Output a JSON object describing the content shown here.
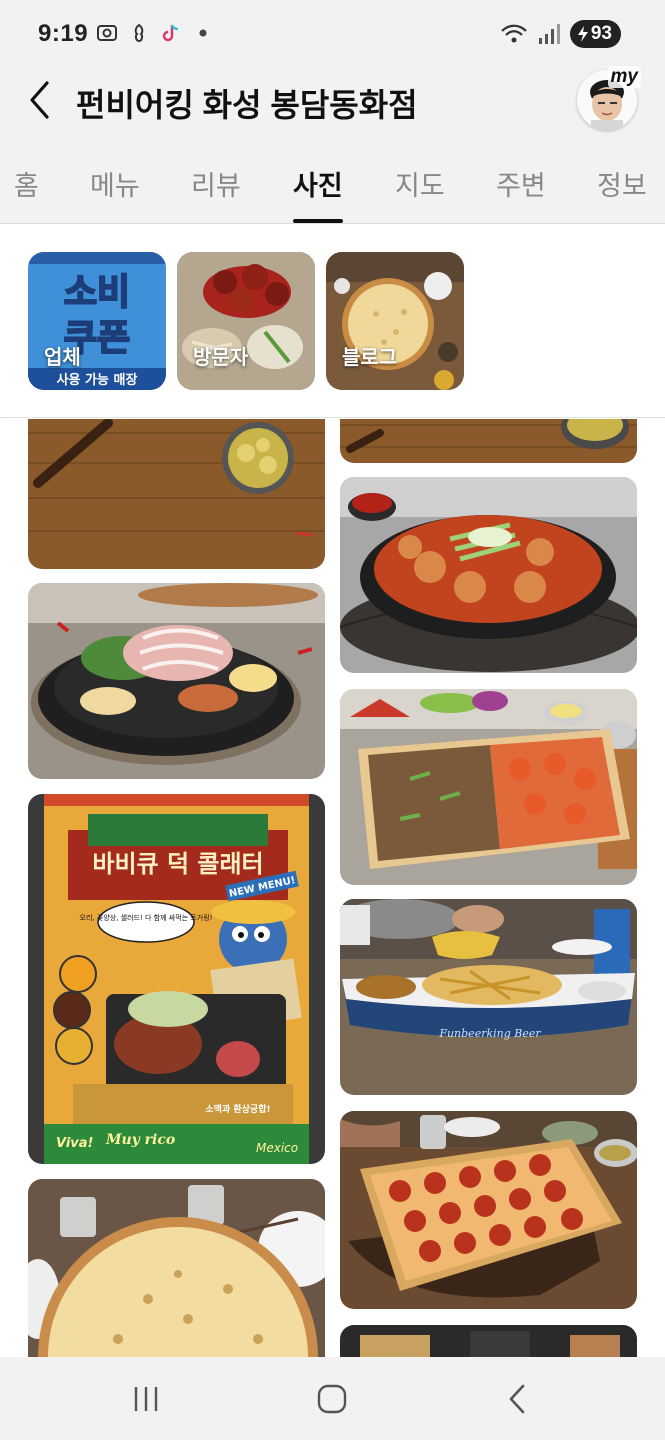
{
  "status_bar": {
    "time": "9:19",
    "battery": "93",
    "icons_left": [
      "screenshot-icon",
      "notification-icon",
      "tiktok-icon",
      "dot-icon"
    ],
    "icons_right": [
      "wifi-icon",
      "signal-icon",
      "battery-icon"
    ]
  },
  "header": {
    "title": "펀비어킹 화성 봉담동화점",
    "avatar_badge": "my"
  },
  "tabs": [
    {
      "label": "홈",
      "active": false
    },
    {
      "label": "메뉴",
      "active": false
    },
    {
      "label": "리뷰",
      "active": false
    },
    {
      "label": "사진",
      "active": true
    },
    {
      "label": "지도",
      "active": false
    },
    {
      "label": "주변",
      "active": false
    },
    {
      "label": "정보",
      "active": false
    }
  ],
  "chips": [
    {
      "label": "업체"
    },
    {
      "label": "방문자"
    },
    {
      "label": "블로그"
    }
  ],
  "coupon_text": {
    "line1": "소비",
    "line2": "쿠폰",
    "footer": "사용 가능 매장"
  },
  "poster": {
    "title": "바비큐 덕 콜래터",
    "badge": "NEW MENU!",
    "bubble": "오리, 꽃양상, 샐러드! 다 함께 싸먹는 토거링!",
    "bottom_left": "Viva!",
    "bottom_mid": "Muy rico",
    "bottom_right": "Mexico",
    "sticker": "소맥과 환상궁합!"
  },
  "boat_text": "Funbeerking Beer",
  "nav": {
    "recents": "recents-icon",
    "home": "home-icon",
    "back": "back-icon"
  },
  "colors": {
    "bg": "#f2f2f2",
    "active_tab": "#111111",
    "inactive_tab": "#888888"
  }
}
